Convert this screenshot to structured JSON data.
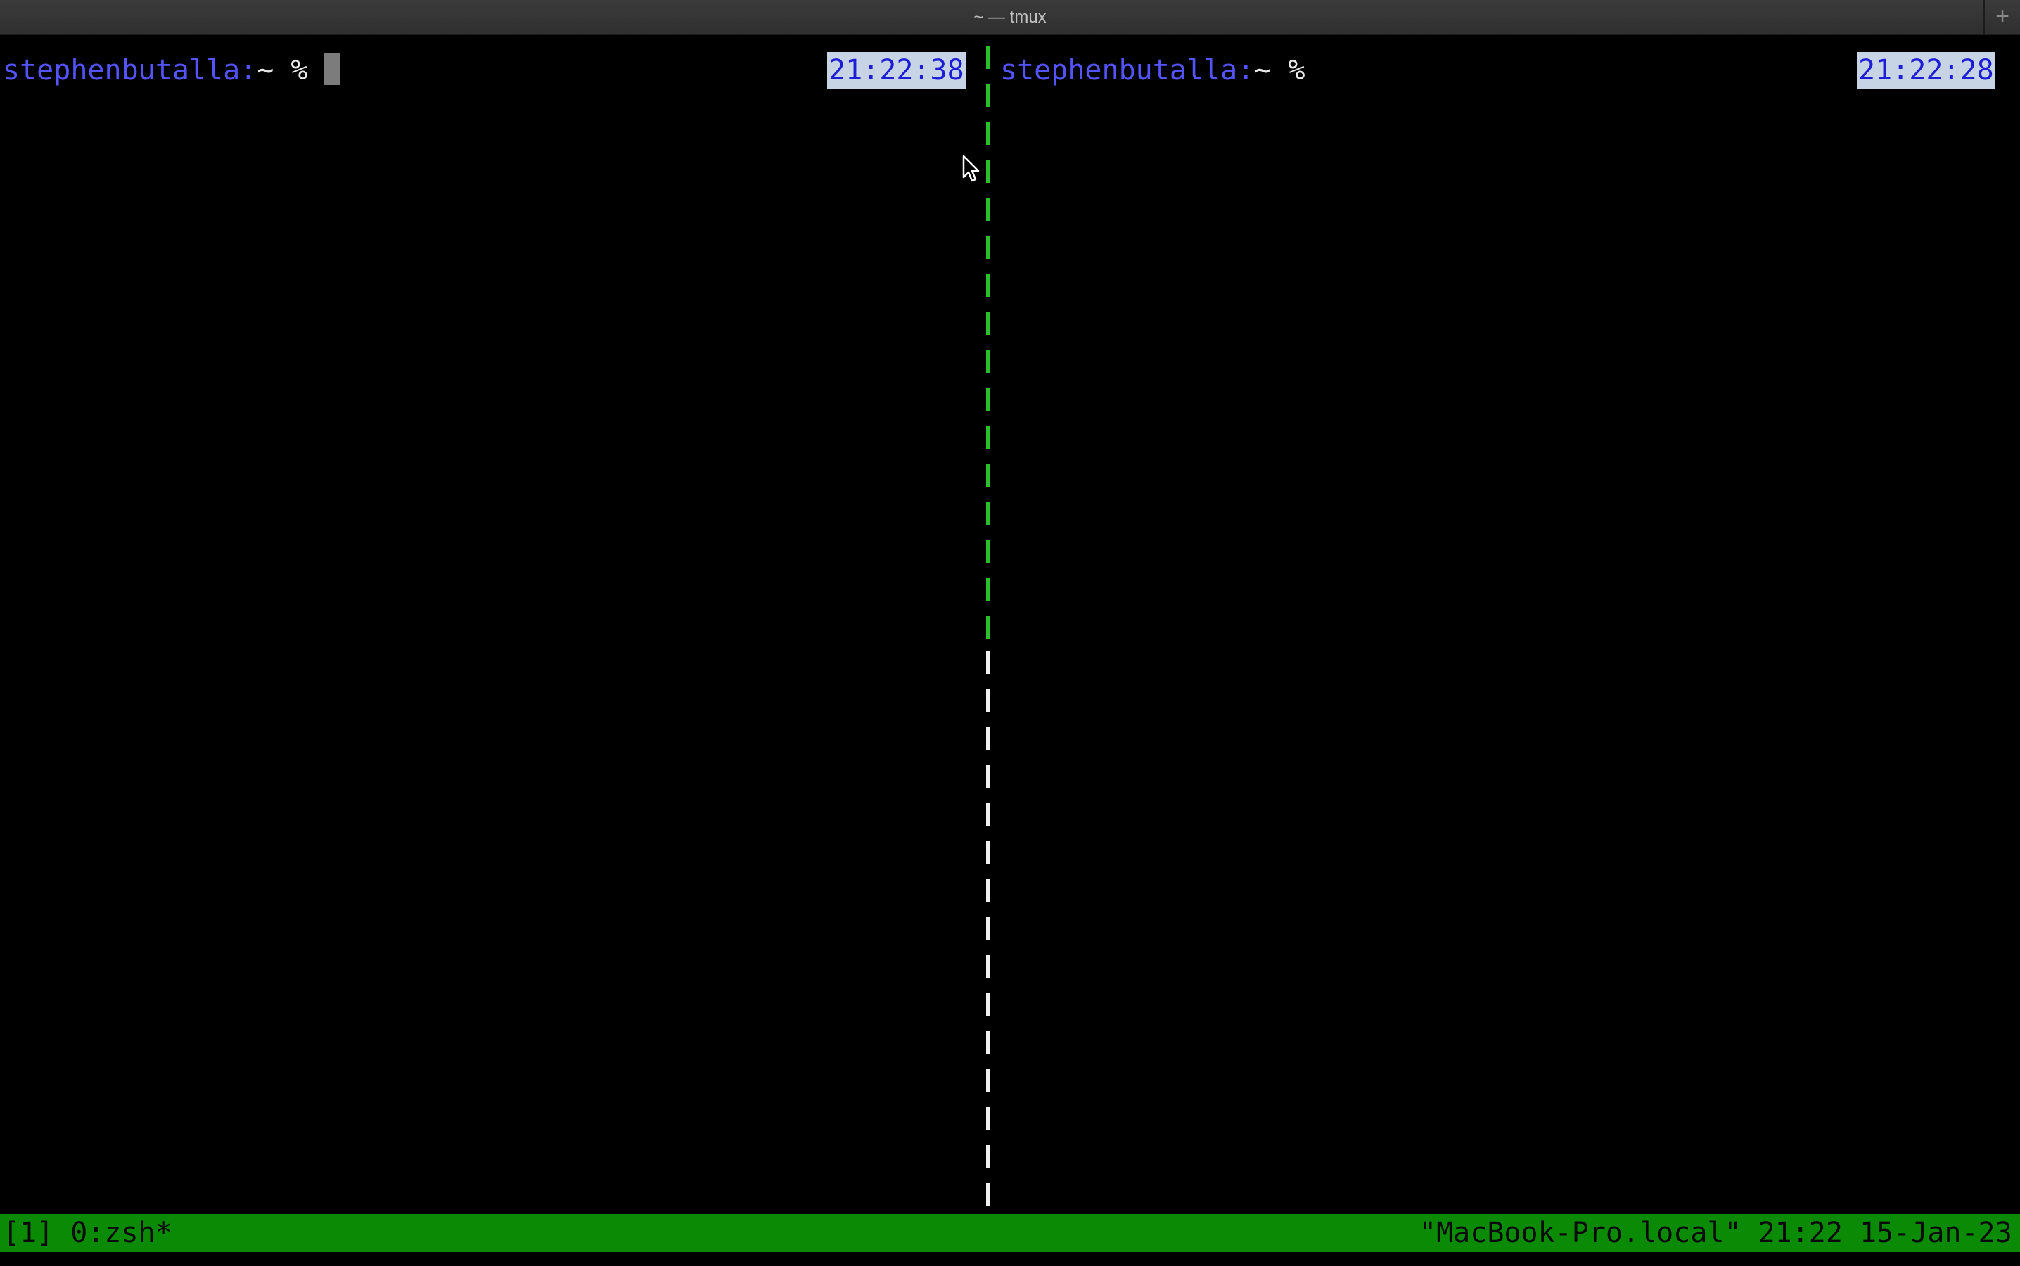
{
  "window": {
    "title": "~ — tmux",
    "new_tab_icon": "plus-icon",
    "new_tab_symbol": "+"
  },
  "panes": {
    "left": {
      "prompt_user": "stephenbutalla:",
      "prompt_rest": "~ %",
      "clock": "21:22:38",
      "active": true
    },
    "right": {
      "prompt_user": "stephenbutalla:",
      "prompt_rest": "~ %",
      "clock": "21:22:28",
      "active": false
    }
  },
  "status_bar": {
    "session": "[1]",
    "window": "0:zsh*",
    "hostname": "\"MacBook-Pro.local\"",
    "time": "21:22",
    "date": "15-Jan-23"
  },
  "colors": {
    "prompt_user": "#5454ff",
    "clock_text": "#1d1dd6",
    "clock_bg": "#c6d4e6",
    "active_border": "#2bbf2b",
    "inactive_border": "#f0f0f0",
    "status_bg": "#0b8a06",
    "terminal_bg": "#000000"
  }
}
